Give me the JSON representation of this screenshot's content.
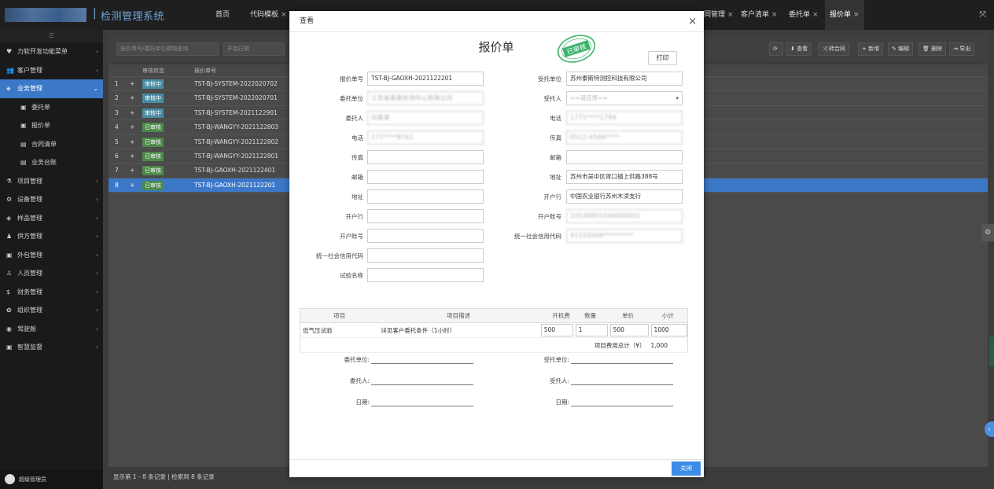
{
  "app": {
    "title": "检测管理系统"
  },
  "top_tabs": [
    {
      "label": "首页",
      "closable": false
    },
    {
      "label": "代码模板",
      "closable": true
    },
    {
      "label": "…同管理",
      "closable": true
    },
    {
      "label": "客户清单",
      "closable": true
    },
    {
      "label": "委托单",
      "closable": true
    },
    {
      "label": "报价单",
      "closable": true,
      "active": true
    }
  ],
  "sidebar": {
    "toggle_icon": "menu-icon",
    "items": [
      {
        "label": "力软开发功能菜单",
        "icon": "heart-icon"
      },
      {
        "label": "客户管理",
        "icon": "users-icon"
      },
      {
        "label": "业务管理",
        "icon": "pin-icon",
        "active": true
      },
      {
        "label": "委托单",
        "icon": "doc-icon",
        "sub": true
      },
      {
        "label": "报价单",
        "icon": "doc-icon",
        "sub": true
      },
      {
        "label": "合同清单",
        "icon": "card-icon",
        "sub": true
      },
      {
        "label": "业务台账",
        "icon": "card-icon",
        "sub": true
      },
      {
        "label": "项目管理",
        "icon": "flask-icon"
      },
      {
        "label": "设备管理",
        "icon": "gears-icon"
      },
      {
        "label": "样品管理",
        "icon": "cube-icon"
      },
      {
        "label": "供方管理",
        "icon": "user-icon"
      },
      {
        "label": "外包管理",
        "icon": "doc-icon"
      },
      {
        "label": "人员管理",
        "icon": "person-icon"
      },
      {
        "label": "财务管理",
        "icon": "dollar-icon"
      },
      {
        "label": "组织管理",
        "icon": "org-icon"
      },
      {
        "label": "驾驶舱",
        "icon": "dashboard-icon"
      },
      {
        "label": "智慧监督",
        "icon": "doc-icon"
      }
    ],
    "user": "超级管理员"
  },
  "toolbar": {
    "search_placeholder": "报价单号/委托单位模糊查询",
    "start_date_placeholder": "开始日期",
    "buttons": [
      "查看",
      "转合同",
      "新增",
      "编辑",
      "删除",
      "导出"
    ]
  },
  "grid": {
    "columns": [
      "审核状态",
      "报价单号"
    ],
    "rows": [
      {
        "n": "1",
        "status": "审核中",
        "status_type": "pending",
        "no": "TST-BJ-SYSTEM-2022020702"
      },
      {
        "n": "2",
        "status": "审核中",
        "status_type": "pending",
        "no": "TST-BJ-SYSTEM-2022020701"
      },
      {
        "n": "3",
        "status": "审核中",
        "status_type": "pending",
        "no": "TST-BJ-SYSTEM-2021122901"
      },
      {
        "n": "4",
        "status": "已审核",
        "status_type": "ok",
        "no": "TST-BJ-WANGYY-2021122803"
      },
      {
        "n": "5",
        "status": "已审核",
        "status_type": "ok",
        "no": "TST-BJ-WANGYY-2021122802"
      },
      {
        "n": "6",
        "status": "已审核",
        "status_type": "ok",
        "no": "TST-BJ-WANGYY-2021122801"
      },
      {
        "n": "7",
        "status": "已审核",
        "status_type": "ok",
        "no": "TST-BJ-GAOXH-2021122401"
      },
      {
        "n": "8",
        "status": "已审核",
        "status_type": "ok",
        "no": "TST-BJ-GAOXH-2021122201",
        "selected": true
      }
    ],
    "footer": "显示第 1 - 8 条记录 | 检索到 8 条记录"
  },
  "modal": {
    "title": "查看",
    "doc_title": "报价单",
    "print_label": "打印",
    "stamp_text": "已审核",
    "close_label": "关闭",
    "left_fields": [
      {
        "label": "报价单号",
        "value": "TST-BJ-GAOXH-2021122201"
      },
      {
        "label": "委托单位",
        "value": "江苏省某某检测中心有限公司",
        "blur": true
      },
      {
        "label": "委托人",
        "value": "刘某某",
        "blur": true
      },
      {
        "label": "电话",
        "value": "177****8761",
        "blur": true
      },
      {
        "label": "传真",
        "value": ""
      },
      {
        "label": "邮箱",
        "value": ""
      },
      {
        "label": "地址",
        "value": ""
      },
      {
        "label": "开户行",
        "value": ""
      },
      {
        "label": "开户账号",
        "value": ""
      },
      {
        "label": "统一社会信用代码",
        "value": ""
      },
      {
        "label": "试验名称",
        "value": ""
      }
    ],
    "right_fields": [
      {
        "label": "受托单位",
        "value": "苏州泰斯特测控科技有限公司"
      },
      {
        "label": "受托人",
        "value": "==请选择==",
        "select": true
      },
      {
        "label": "电话",
        "value": "1771****1794",
        "blur": true
      },
      {
        "label": "传真",
        "value": "0512-6586****",
        "blur": true
      },
      {
        "label": "邮箱",
        "value": ""
      },
      {
        "label": "地址",
        "value": "苏州市吴中区胥口镇上供路388号"
      },
      {
        "label": "开户行",
        "value": "中国农业银行苏州木渎支行"
      },
      {
        "label": "开户账号",
        "value": "10538001040000002",
        "blur": true
      },
      {
        "label": "统一社会信用代码",
        "value": "91320506*********",
        "blur": true
      }
    ],
    "items_table": {
      "headers": [
        "项目",
        "项目描述",
        "开机费",
        "数量",
        "单价",
        "小计"
      ],
      "rows": [
        {
          "project": "低气压试验",
          "desc": "详见客户委托条件（1小时）",
          "fee": "500",
          "qty": "1",
          "price": "500",
          "subtotal": "1000"
        }
      ],
      "total_label": "项目费用总计（¥）",
      "total_value": "1,000"
    },
    "signatures": {
      "left": [
        "委托单位:",
        "委托人:",
        "日期:"
      ],
      "right": [
        "受托单位:",
        "受托人:",
        "日期:"
      ]
    }
  }
}
